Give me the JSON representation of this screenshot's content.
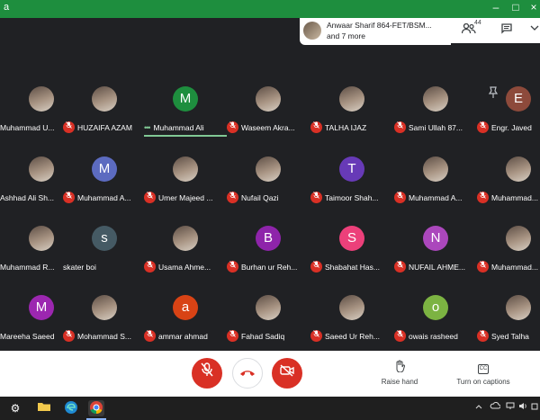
{
  "window": {
    "title_bar_text": "a",
    "controls": [
      "–",
      "□",
      "×"
    ]
  },
  "header": {
    "presenter_chip": {
      "line1": "Anwaar Sharif 864-FET/BSM...",
      "line2": "and 7 more"
    },
    "people_count": "44",
    "icons": [
      "people-icon",
      "chat-icon",
      "activities-icon"
    ]
  },
  "participants": [
    {
      "name": "Muhammad U...",
      "muted": false,
      "avatar": "photo"
    },
    {
      "name": "HUZAIFA AZAM",
      "muted": true,
      "avatar": "photo"
    },
    {
      "name": "Muhammad Ali",
      "muted": false,
      "avatar": "M",
      "color": "#1e8e3e",
      "speaking": true
    },
    {
      "name": "Waseem Akra...",
      "muted": true,
      "avatar": "photo"
    },
    {
      "name": "TALHA IJAZ",
      "muted": true,
      "avatar": "photo"
    },
    {
      "name": "Sami Ullah 87...",
      "muted": true,
      "avatar": "photo"
    },
    {
      "name": "Engr. Javed",
      "muted": true,
      "avatar": "E",
      "color": "#8d4a3b"
    },
    {
      "name": "Ashhad Ali Sh...",
      "muted": false,
      "avatar": "photo"
    },
    {
      "name": "Muhammad A...",
      "muted": true,
      "avatar": "M",
      "color": "#5c6bc0"
    },
    {
      "name": "Umer Majeed ...",
      "muted": true,
      "avatar": "photo"
    },
    {
      "name": "Nufail Qazi",
      "muted": true,
      "avatar": "photo"
    },
    {
      "name": "Taimoor Shah...",
      "muted": true,
      "avatar": "T",
      "color": "#673ab7"
    },
    {
      "name": "Muhammad A...",
      "muted": true,
      "avatar": "photo"
    },
    {
      "name": "Muhammad...",
      "muted": true,
      "avatar": "photo"
    },
    {
      "name": "Muhammad R...",
      "muted": false,
      "avatar": "photo"
    },
    {
      "name": "skater boi",
      "muted": false,
      "avatar": "s",
      "color": "#455a64"
    },
    {
      "name": "Usama Ahme...",
      "muted": true,
      "avatar": "photo"
    },
    {
      "name": "Burhan ur Reh...",
      "muted": true,
      "avatar": "B",
      "color": "#8e24aa"
    },
    {
      "name": "Shabahat Has...",
      "muted": true,
      "avatar": "S",
      "color": "#ec407a"
    },
    {
      "name": "NUFAIL AHME...",
      "muted": true,
      "avatar": "N",
      "color": "#ab47bc"
    },
    {
      "name": "Muhammad...",
      "muted": true,
      "avatar": "photo"
    },
    {
      "name": "Mareeha Saeed",
      "muted": false,
      "avatar": "M",
      "color": "#9c27b0"
    },
    {
      "name": "Mohammad S...",
      "muted": true,
      "avatar": "photo"
    },
    {
      "name": "ammar ahmad",
      "muted": true,
      "avatar": "a",
      "color": "#d84315"
    },
    {
      "name": "Fahad Sadiq",
      "muted": true,
      "avatar": "photo"
    },
    {
      "name": "Saeed Ur Reh...",
      "muted": true,
      "avatar": "photo"
    },
    {
      "name": "owais rasheed",
      "muted": true,
      "avatar": "o",
      "color": "#7cb342"
    },
    {
      "name": "Syed Talha",
      "muted": true,
      "avatar": "photo"
    }
  ],
  "controls": {
    "raise_hand_label": "Raise hand",
    "captions_label": "Turn on captions",
    "captions_icon_text": "CC"
  }
}
